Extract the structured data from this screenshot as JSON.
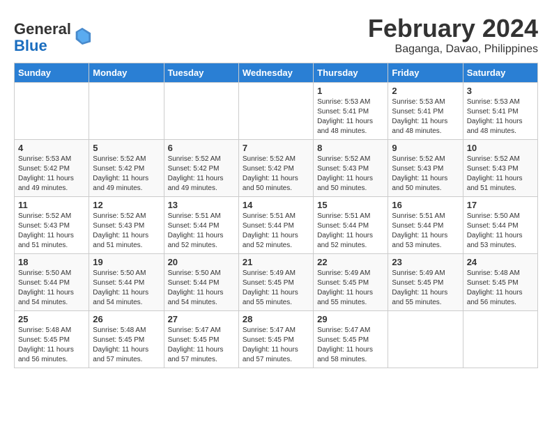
{
  "header": {
    "logo_line1": "General",
    "logo_line2": "Blue",
    "title": "February 2024",
    "subtitle": "Baganga, Davao, Philippines"
  },
  "calendar": {
    "days_of_week": [
      "Sunday",
      "Monday",
      "Tuesday",
      "Wednesday",
      "Thursday",
      "Friday",
      "Saturday"
    ],
    "weeks": [
      [
        {
          "day": "",
          "info": ""
        },
        {
          "day": "",
          "info": ""
        },
        {
          "day": "",
          "info": ""
        },
        {
          "day": "",
          "info": ""
        },
        {
          "day": "1",
          "info": "Sunrise: 5:53 AM\nSunset: 5:41 PM\nDaylight: 11 hours\nand 48 minutes."
        },
        {
          "day": "2",
          "info": "Sunrise: 5:53 AM\nSunset: 5:41 PM\nDaylight: 11 hours\nand 48 minutes."
        },
        {
          "day": "3",
          "info": "Sunrise: 5:53 AM\nSunset: 5:41 PM\nDaylight: 11 hours\nand 48 minutes."
        }
      ],
      [
        {
          "day": "4",
          "info": "Sunrise: 5:53 AM\nSunset: 5:42 PM\nDaylight: 11 hours\nand 49 minutes."
        },
        {
          "day": "5",
          "info": "Sunrise: 5:52 AM\nSunset: 5:42 PM\nDaylight: 11 hours\nand 49 minutes."
        },
        {
          "day": "6",
          "info": "Sunrise: 5:52 AM\nSunset: 5:42 PM\nDaylight: 11 hours\nand 49 minutes."
        },
        {
          "day": "7",
          "info": "Sunrise: 5:52 AM\nSunset: 5:42 PM\nDaylight: 11 hours\nand 50 minutes."
        },
        {
          "day": "8",
          "info": "Sunrise: 5:52 AM\nSunset: 5:43 PM\nDaylight: 11 hours\nand 50 minutes."
        },
        {
          "day": "9",
          "info": "Sunrise: 5:52 AM\nSunset: 5:43 PM\nDaylight: 11 hours\nand 50 minutes."
        },
        {
          "day": "10",
          "info": "Sunrise: 5:52 AM\nSunset: 5:43 PM\nDaylight: 11 hours\nand 51 minutes."
        }
      ],
      [
        {
          "day": "11",
          "info": "Sunrise: 5:52 AM\nSunset: 5:43 PM\nDaylight: 11 hours\nand 51 minutes."
        },
        {
          "day": "12",
          "info": "Sunrise: 5:52 AM\nSunset: 5:43 PM\nDaylight: 11 hours\nand 51 minutes."
        },
        {
          "day": "13",
          "info": "Sunrise: 5:51 AM\nSunset: 5:44 PM\nDaylight: 11 hours\nand 52 minutes."
        },
        {
          "day": "14",
          "info": "Sunrise: 5:51 AM\nSunset: 5:44 PM\nDaylight: 11 hours\nand 52 minutes."
        },
        {
          "day": "15",
          "info": "Sunrise: 5:51 AM\nSunset: 5:44 PM\nDaylight: 11 hours\nand 52 minutes."
        },
        {
          "day": "16",
          "info": "Sunrise: 5:51 AM\nSunset: 5:44 PM\nDaylight: 11 hours\nand 53 minutes."
        },
        {
          "day": "17",
          "info": "Sunrise: 5:50 AM\nSunset: 5:44 PM\nDaylight: 11 hours\nand 53 minutes."
        }
      ],
      [
        {
          "day": "18",
          "info": "Sunrise: 5:50 AM\nSunset: 5:44 PM\nDaylight: 11 hours\nand 54 minutes."
        },
        {
          "day": "19",
          "info": "Sunrise: 5:50 AM\nSunset: 5:44 PM\nDaylight: 11 hours\nand 54 minutes."
        },
        {
          "day": "20",
          "info": "Sunrise: 5:50 AM\nSunset: 5:44 PM\nDaylight: 11 hours\nand 54 minutes."
        },
        {
          "day": "21",
          "info": "Sunrise: 5:49 AM\nSunset: 5:45 PM\nDaylight: 11 hours\nand 55 minutes."
        },
        {
          "day": "22",
          "info": "Sunrise: 5:49 AM\nSunset: 5:45 PM\nDaylight: 11 hours\nand 55 minutes."
        },
        {
          "day": "23",
          "info": "Sunrise: 5:49 AM\nSunset: 5:45 PM\nDaylight: 11 hours\nand 55 minutes."
        },
        {
          "day": "24",
          "info": "Sunrise: 5:48 AM\nSunset: 5:45 PM\nDaylight: 11 hours\nand 56 minutes."
        }
      ],
      [
        {
          "day": "25",
          "info": "Sunrise: 5:48 AM\nSunset: 5:45 PM\nDaylight: 11 hours\nand 56 minutes."
        },
        {
          "day": "26",
          "info": "Sunrise: 5:48 AM\nSunset: 5:45 PM\nDaylight: 11 hours\nand 57 minutes."
        },
        {
          "day": "27",
          "info": "Sunrise: 5:47 AM\nSunset: 5:45 PM\nDaylight: 11 hours\nand 57 minutes."
        },
        {
          "day": "28",
          "info": "Sunrise: 5:47 AM\nSunset: 5:45 PM\nDaylight: 11 hours\nand 57 minutes."
        },
        {
          "day": "29",
          "info": "Sunrise: 5:47 AM\nSunset: 5:45 PM\nDaylight: 11 hours\nand 58 minutes."
        },
        {
          "day": "",
          "info": ""
        },
        {
          "day": "",
          "info": ""
        }
      ]
    ]
  }
}
